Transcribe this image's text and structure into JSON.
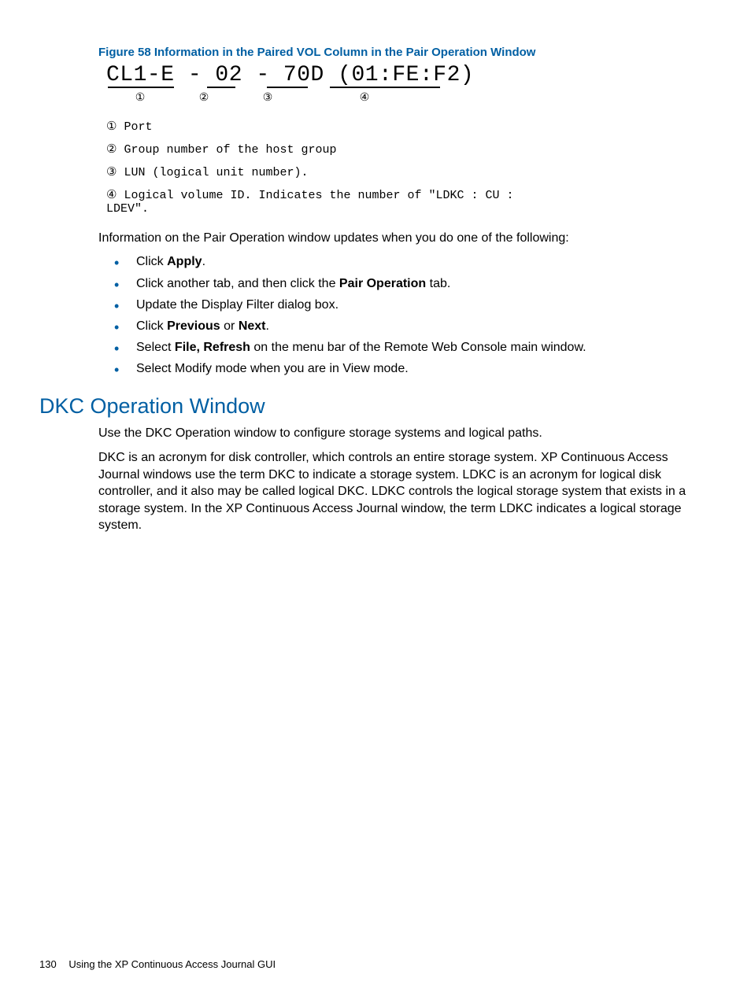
{
  "figure": {
    "caption": "Figure 58 Information in the Paired VOL Column in the Pair Operation Window",
    "main_string": "CL1-E - 02 - 70D (01:FE:F2)",
    "circled_labels": [
      "①",
      "②",
      "③",
      "④"
    ],
    "legend": [
      {
        "num": "①",
        "text": "Port"
      },
      {
        "num": "②",
        "text": "Group number of the host group"
      },
      {
        "num": "③",
        "text": "LUN (logical unit number)."
      },
      {
        "num": "④",
        "text": "Logical volume ID. Indicates the number of \"LDKC : CU : LDEV\"."
      }
    ]
  },
  "intro_sentence": "Information on the Pair Operation window updates when you do one of the following:",
  "bullets": [
    {
      "pre": "Click ",
      "bold1": "Apply",
      "mid": ".",
      "bold2": "",
      "post": ""
    },
    {
      "pre": "Click another tab, and then click the ",
      "bold1": "Pair Operation",
      "mid": " tab.",
      "bold2": "",
      "post": ""
    },
    {
      "pre": "Update the Display Filter dialog box.",
      "bold1": "",
      "mid": "",
      "bold2": "",
      "post": ""
    },
    {
      "pre": "Click ",
      "bold1": "Previous",
      "mid": " or ",
      "bold2": "Next",
      "post": "."
    },
    {
      "pre": "Select ",
      "bold1": "File, Refresh",
      "mid": " on the menu bar of the Remote Web Console main window.",
      "bold2": "",
      "post": ""
    },
    {
      "pre": "Select Modify mode when you are in View mode.",
      "bold1": "",
      "mid": "",
      "bold2": "",
      "post": ""
    }
  ],
  "section": {
    "heading": "DKC Operation Window",
    "para1": "Use the DKC Operation window to configure storage systems and logical paths.",
    "para2": "DKC is an acronym for disk controller, which controls an entire storage system. XP Continuous Access Journal windows use the term DKC to indicate a storage system. LDKC is an acronym for logical disk controller, and it also may be called logical DKC. LDKC controls the logical storage system that exists in a storage system. In the XP Continuous Access Journal window, the term LDKC indicates a logical storage system."
  },
  "footer": {
    "page": "130",
    "chapter": "Using the XP Continuous Access Journal GUI"
  }
}
